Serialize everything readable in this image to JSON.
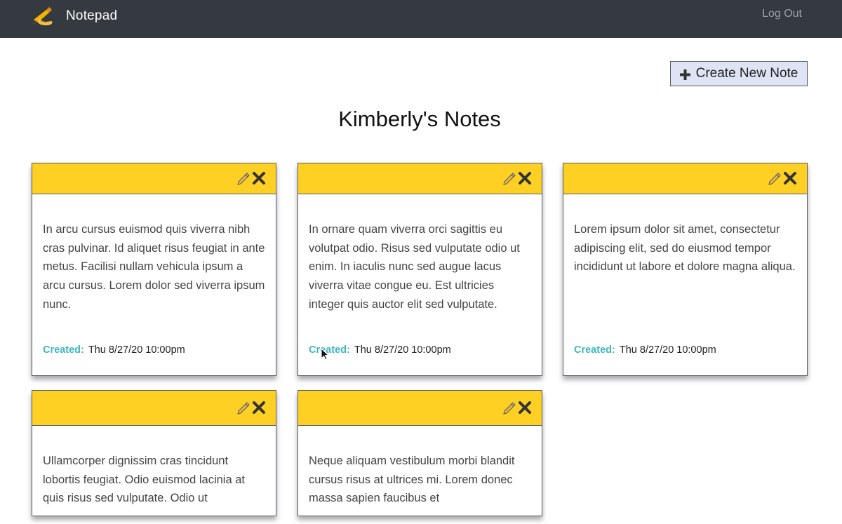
{
  "navbar": {
    "brand_name": "Notepad",
    "brand_icon": "writing-hand-icon",
    "logout_label": "Log Out",
    "background": "#343a40"
  },
  "toolbar": {
    "create_label": "Create New Note",
    "create_icon": "plus-icon"
  },
  "page": {
    "title": "Kimberly's Notes"
  },
  "colors": {
    "note_header": "#fdd023",
    "created_label": "#3fb6c3",
    "create_button_bg": "#dfe4f5"
  },
  "notes": [
    {
      "body": "In arcu cursus euismod quis viverra nibh cras pulvinar. Id aliquet risus feugiat in ante metus. Facilisi nullam vehicula ipsum a arcu cursus. Lorem dolor sed viverra ipsum nunc.",
      "created_label": "Created:",
      "created_date": "Thu 8/27/20 10:00pm"
    },
    {
      "body": "In ornare quam viverra orci sagittis eu volutpat odio. Risus sed vulputate odio ut enim. In iaculis nunc sed augue lacus viverra vitae congue eu. Est ultricies integer quis auctor elit sed vulputate.",
      "created_label": "Created:",
      "created_date": "Thu 8/27/20 10:00pm"
    },
    {
      "body": "Lorem ipsum dolor sit amet, consectetur adipiscing elit, sed do eiusmod tempor incididunt ut labore et dolore magna aliqua.",
      "created_label": "Created:",
      "created_date": "Thu 8/27/20 10:00pm"
    },
    {
      "body": "Ullamcorper dignissim cras tincidunt lobortis feugiat. Odio euismod lacinia at quis risus sed vulputate. Odio ut"
    },
    {
      "body": "Neque aliquam vestibulum morbi blandit cursus risus at ultrices mi. Lorem donec massa sapien faucibus et"
    }
  ]
}
